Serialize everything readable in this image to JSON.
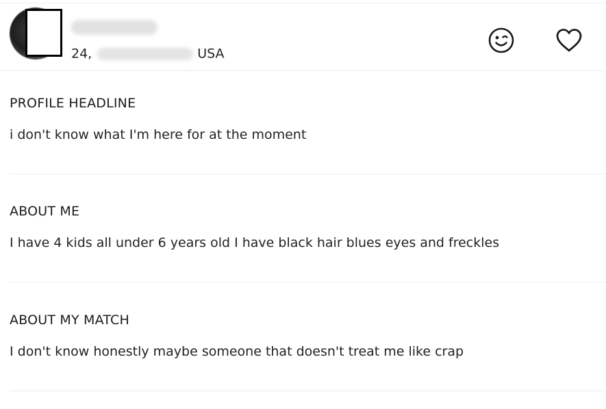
{
  "profile": {
    "age": "24,",
    "country": "USA",
    "icons": {
      "wink": "wink-face-icon",
      "favorite": "heart-icon"
    }
  },
  "sections": [
    {
      "heading": "PROFILE HEADLINE",
      "text": "i don't know what I'm here for at the moment"
    },
    {
      "heading": "ABOUT ME",
      "text": "I have 4 kids all under 6 years old I have black hair blues eyes and freckles"
    },
    {
      "heading": "ABOUT MY MATCH",
      "text": "I don't know honestly maybe someone that doesn't treat me like crap"
    }
  ]
}
